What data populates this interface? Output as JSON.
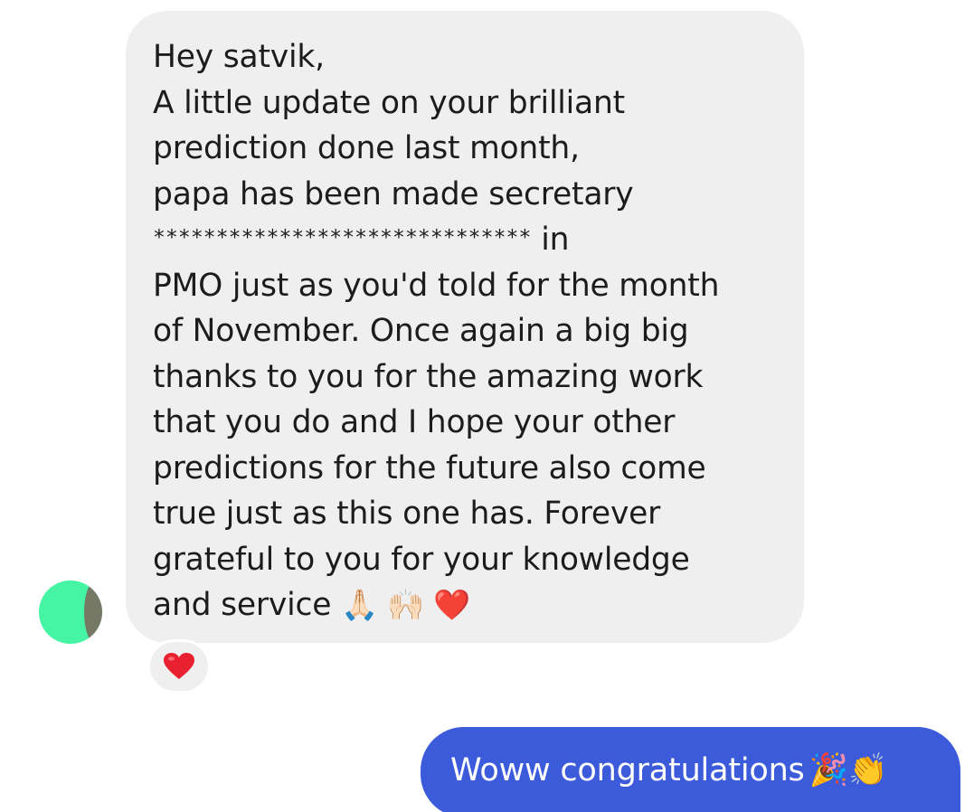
{
  "incoming_message": {
    "lines": [
      "Hey satvik,",
      "A little update on your brilliant",
      "prediction done last month,",
      "papa has been made secretary",
      "PMO just as you'd told for the month",
      "of November. Once again a big big",
      "thanks to you for the amazing work",
      "that you do and I hope your other",
      "predictions for the future also come",
      "true just as this one has. Forever",
      "grateful to you for your knowledge",
      "and service"
    ],
    "redacted_text": "******************************",
    "redacted_suffix": "in",
    "trailing_emojis": "🙏🏻 🙌🏻 ❤️"
  },
  "reaction": {
    "icon": "heart-icon",
    "color": "#e8202f"
  },
  "avatar": {
    "color": "#45f5a4"
  },
  "outgoing_message": {
    "text": "Woww congratulations",
    "emojis": "🎉👏",
    "bubble_color": "#3b5bdb"
  }
}
